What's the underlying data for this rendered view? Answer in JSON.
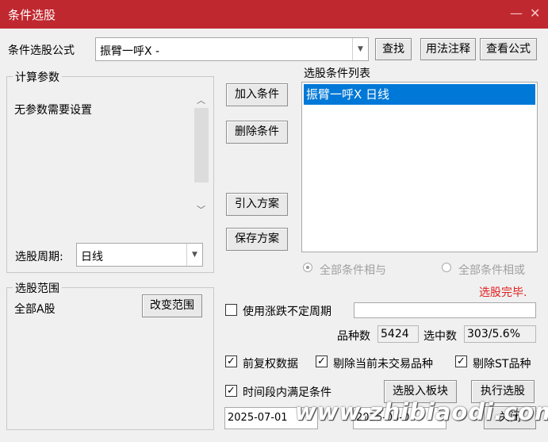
{
  "window": {
    "title": "条件选股",
    "minimize_glyph": "—",
    "close_glyph": "✕"
  },
  "formula": {
    "label": "条件选股公式",
    "value": "振臂一呼X  -",
    "find_button": "查找",
    "usage_button": "用法注释",
    "view_button": "查看公式"
  },
  "params": {
    "group_label": "计算参数",
    "message": "无参数需要设置",
    "period_label": "选股周期:",
    "period_value": "日线"
  },
  "actions": {
    "add": "加入条件",
    "delete": "删除条件",
    "import": "引入方案",
    "save": "保存方案"
  },
  "condition_list": {
    "label": "选股条件列表",
    "items": [
      "振臂一呼X  日线"
    ]
  },
  "logic": {
    "and_label": "全部条件相与",
    "or_label": "全部条件相或"
  },
  "status": {
    "text": "选股完毕.",
    "color": "#e02020"
  },
  "scope": {
    "group_label": "选股范围",
    "value": "全部A股",
    "change_button": "改变范围"
  },
  "options": {
    "irregular_period_label": "使用涨跌不定周期",
    "irregular_period_checked": false,
    "irregular_period_value": "",
    "count_label": "品种数",
    "count_value": "5424",
    "selected_label": "选中数",
    "selected_value": "303/5.6%",
    "adjust_label": "前复权数据",
    "exclude_untraded_label": "剔除当前未交易品种",
    "exclude_st_label": "剔除ST品种",
    "period_satisfy_label": "时间段内满足条件"
  },
  "bottom": {
    "to_block_button": "选股入板块",
    "execute_button": "执行选股",
    "start_date": "2025-07-01",
    "end_date": "2025-08-0",
    "close_button": "关闭"
  },
  "watermark": "www.zhibiaodi.com",
  "icons": {
    "dropdown": "chevron-down-icon",
    "scroll_up": "chevron-up-icon",
    "scroll_down": "chevron-down-icon",
    "check": "checkmark-icon"
  }
}
